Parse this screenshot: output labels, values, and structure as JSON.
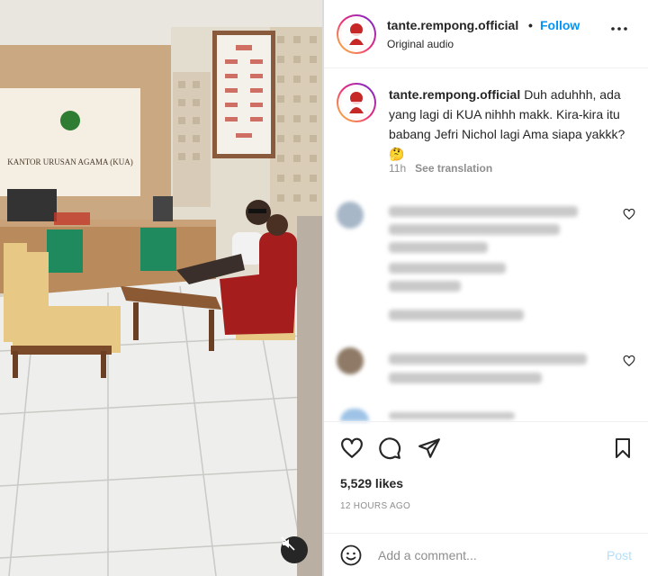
{
  "post": {
    "username": "tante.rempong.official",
    "separator": "•",
    "follow_label": "Follow",
    "audio_label": "Original audio",
    "more_icon": "more-horizontal-icon",
    "media_sign": "KANTOR URUSAN AGAMA (KUA)"
  },
  "caption": {
    "username": "tante.rempong.official",
    "text": "Duh aduhhh, ada yang lagi di KUA nihhh makk. Kira-kira itu babang Jefri Nichol lagi Ama siapa yakkk? 🤔",
    "time": "11h",
    "see_translation": "See translation"
  },
  "actions": {
    "like_icon": "heart-icon",
    "comment_icon": "comment-icon",
    "share_icon": "send-icon",
    "save_icon": "bookmark-icon",
    "likes": "5,529 likes",
    "time_ago": "12 HOURS AGO"
  },
  "comment_bar": {
    "placeholder": "Add a comment...",
    "post_label": "Post"
  },
  "colors": {
    "accent": "#0095f6",
    "muted": "#8e8e8e",
    "post_disabled": "#b2dffc"
  }
}
